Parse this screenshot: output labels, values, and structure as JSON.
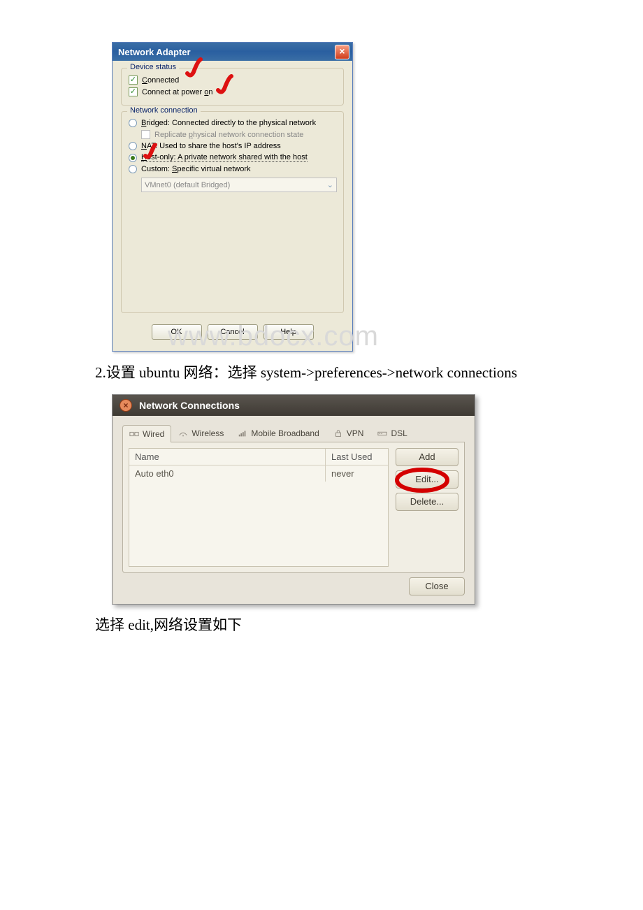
{
  "dialog1": {
    "title": "Network Adapter",
    "group1_legend": "Device status",
    "connected_label_pre": "C",
    "connected_label": "onnected",
    "poweron_label": "Connect at power on",
    "poweron_underline": "o",
    "group2_legend": "Network connection",
    "bridged_pre": "B",
    "bridged_label": "ridged: Connected directly to the physical network",
    "replicate_pre": "Replicate ",
    "replicate_u": "p",
    "replicate_post": "hysical network connection state",
    "nat_pre": "N",
    "nat_label": "AT: Used to share the host's IP address",
    "host_label_pre": "H",
    "host_label": "ost-only: A private network shared with the host",
    "custom_label_pre": "Custom: ",
    "custom_u": "S",
    "custom_label_post": "pecific virtual network",
    "combo_value": "VMnet0 (default Bridged)",
    "ok": "OK",
    "cancel": "Cancel",
    "help": "Help"
  },
  "watermark": "www.bdocx.com",
  "instr1": "2.设置 ubuntu 网络：选择 system->preferences->network connections",
  "dialog2": {
    "title": "Network Connections",
    "tabs": {
      "wired": "Wired",
      "wireless": "Wireless",
      "mobile": "Mobile Broadband",
      "vpn": "VPN",
      "dsl": "DSL"
    },
    "col_name": "Name",
    "col_last": "Last Used",
    "row_name": "Auto eth0",
    "row_last": "never",
    "btn_add": "Add",
    "btn_edit": "Edit...",
    "btn_delete": "Delete...",
    "btn_close": "Close"
  },
  "instr2": "选择 edit,网络设置如下"
}
